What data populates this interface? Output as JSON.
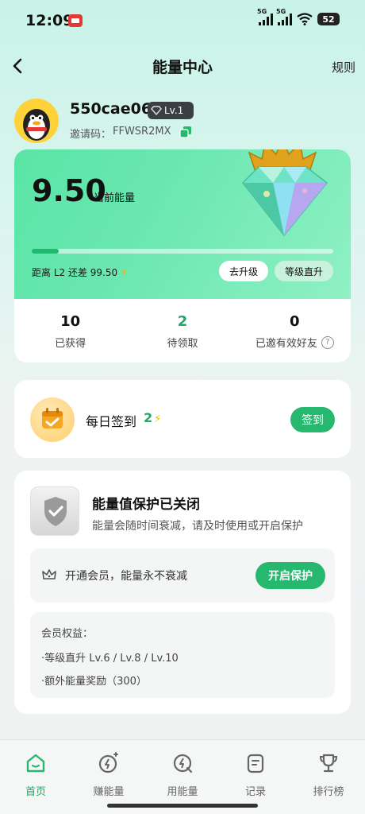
{
  "status_bar": {
    "time": "12:09",
    "signal1_label": "5G",
    "signal2_label": "5G",
    "battery": "52"
  },
  "nav": {
    "title": "能量中心",
    "rules_label": "规则",
    "back_icon": "chevron-left-icon"
  },
  "profile": {
    "username": "550cae06",
    "level": "Lv.1",
    "invite_label": "邀请码：",
    "invite_code": "FFWSR2MX"
  },
  "energy": {
    "value": "9.50",
    "value_label": "当前能量",
    "progress_fraction": 0.09,
    "distance_text": "距离 L2 还差 99.50",
    "upgrade_label": "去升级",
    "level_up_label": "等级直升"
  },
  "stats": [
    {
      "value": "10",
      "label": "已获得"
    },
    {
      "value": "2",
      "label": "待领取"
    },
    {
      "value": "0",
      "label": "已邀有效好友"
    }
  ],
  "checkin": {
    "title": "每日签到",
    "reward": "2",
    "button_label": "签到"
  },
  "protection": {
    "title": "能量值保护已关闭",
    "description": "能量会随时间衰减，请及时使用或开启保护",
    "member_text": "开通会员，能量永不衰减",
    "enable_label": "开启保护",
    "benefits_title": "会员权益：",
    "benefits": [
      "·等级直升 Lv.6 / Lv.8 / Lv.10",
      "·额外能量奖励（300）"
    ]
  },
  "tabs": [
    {
      "label": "首页",
      "icon": "home-icon",
      "active": true
    },
    {
      "label": "赚能量",
      "icon": "earn-energy-icon",
      "active": false
    },
    {
      "label": "用能量",
      "icon": "use-energy-icon",
      "active": false
    },
    {
      "label": "记录",
      "icon": "records-icon",
      "active": false
    },
    {
      "label": "排行榜",
      "icon": "trophy-icon",
      "active": false
    }
  ],
  "colors": {
    "accent": "#25b86e",
    "card_green": "#6ae7b0",
    "bolt": "#f5b400"
  }
}
